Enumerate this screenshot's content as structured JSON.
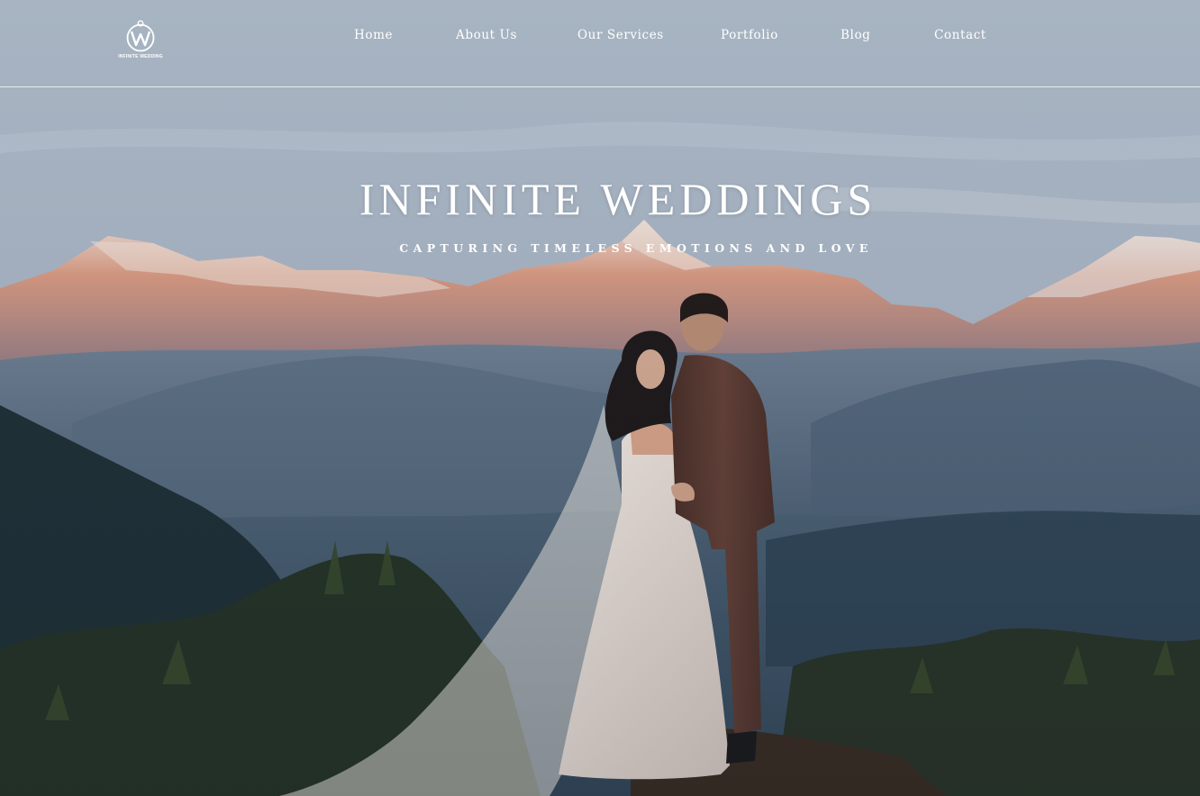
{
  "brand": {
    "name": "INFINITE WEDDING"
  },
  "nav": {
    "items": [
      {
        "label": "Home"
      },
      {
        "label": "About Us"
      },
      {
        "label": "Our Services"
      },
      {
        "label": "Portfolio"
      },
      {
        "label": "Blog"
      },
      {
        "label": "Contact"
      }
    ]
  },
  "hero": {
    "title": "INFINITE WEDDINGS",
    "subtitle": "CAPTURING TIMELESS EMOTIONS AND LOVE",
    "colors": {
      "sky": "#a8b5c4",
      "mountain_glow": "#d8937a",
      "snow": "#f0e2da",
      "valley": "#4f6479",
      "foliage": "#2c3a2f",
      "dress": "#ece2dc",
      "suit": "#5a3a30"
    }
  }
}
